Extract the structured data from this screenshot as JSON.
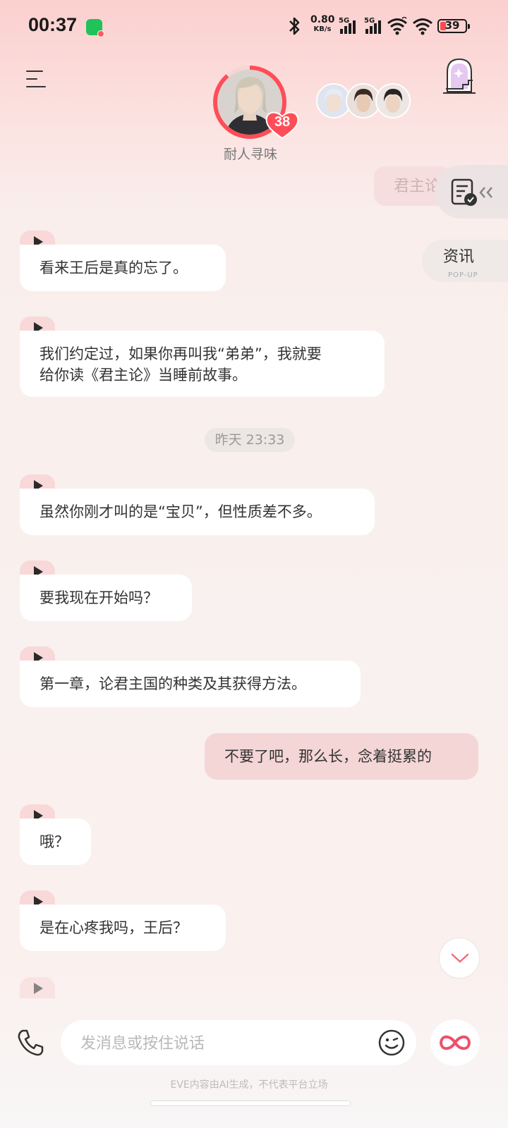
{
  "status_bar": {
    "time": "00:37",
    "net_speed": "0.80",
    "net_unit": "KB/s",
    "sim1": "5G",
    "sim2": "5G",
    "battery": "39"
  },
  "header": {
    "character_name": "耐人寻味",
    "affinity_level": "38"
  },
  "side": {
    "partial_bubble": "君主论",
    "popup_label": "资讯",
    "popup_sub": "POP-UP"
  },
  "messages": [
    {
      "from": "bot",
      "text": "看来王后是真的忘了。"
    },
    {
      "from": "bot",
      "text": "我们约定过，如果你再叫我“弟弟”，我就要\n给你读《君主论》当睡前故事。"
    },
    {
      "from": "time",
      "text": "昨天 23:33"
    },
    {
      "from": "bot",
      "text": "虽然你刚才叫的是“宝贝”，但性质差不多。"
    },
    {
      "from": "bot",
      "text": "要我现在开始吗？"
    },
    {
      "from": "bot",
      "text": "第一章，论君主国的种类及其获得方法。"
    },
    {
      "from": "user",
      "text": "不要了吧，那么长，念着挺累的"
    },
    {
      "from": "bot",
      "text": "哦？"
    },
    {
      "from": "bot",
      "text": "是在心疼我吗，王后？"
    }
  ],
  "input": {
    "placeholder": "发消息或按住说话",
    "value": ""
  },
  "footer": {
    "disclaimer": "EVE内容由AI生成，不代表平台立场"
  },
  "icons": [
    "wechat-icon",
    "bluetooth-icon",
    "wifi-icon",
    "menu-icon",
    "castle-icon",
    "notes-icon",
    "phone-icon",
    "emoji-icon",
    "infinity-icon",
    "chevron-down-icon",
    "play-icon"
  ],
  "colors": {
    "accent": "#ff4d57",
    "user_bubble": "#f4d6d6",
    "bot_bubble": "#ffffff",
    "voice_tab": "#f8d8d8"
  }
}
